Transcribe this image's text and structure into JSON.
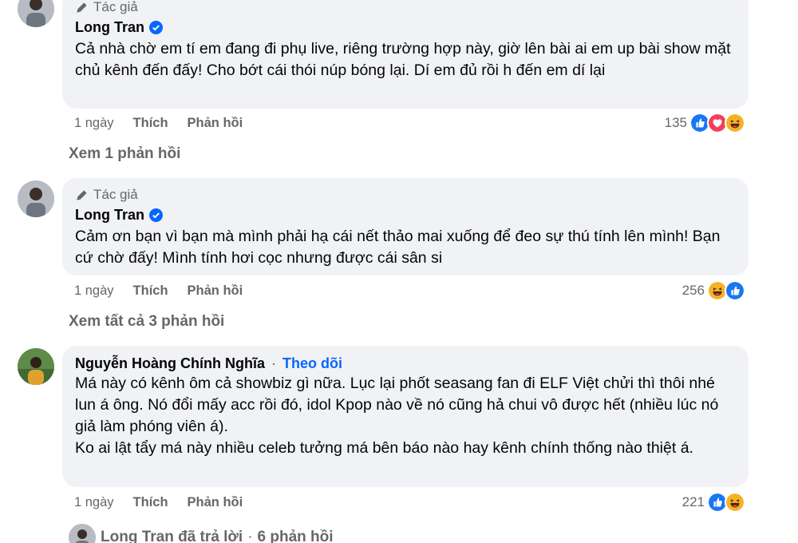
{
  "comments": [
    {
      "badge": "Tác giả",
      "author": "Long Tran",
      "verified": true,
      "text": "Cả nhà chờ em tí em đang đi phụ live, riêng trường hợp này, giờ lên bài ai em up bài show mặt chủ kênh đến đấy! Cho bớt cái thói núp bóng lại. Dí em đủ rồi h đến em dí lại",
      "time": "1 ngày",
      "like_label": "Thích",
      "reply_label": "Phản hồi",
      "reaction_count": "135",
      "reactions": [
        "like",
        "love",
        "haha"
      ],
      "view_replies": "Xem 1 phản hồi"
    },
    {
      "badge": "Tác giả",
      "author": "Long Tran",
      "verified": true,
      "text": "Cảm ơn bạn vì bạn mà mình phải hạ cái nết thảo mai xuống để đeo sự thú tính lên mình! Bạn cứ chờ đấy! Mình tính hơi cọc nhưng được cái sân si",
      "time": "1 ngày",
      "like_label": "Thích",
      "reply_label": "Phản hồi",
      "reaction_count": "256",
      "reactions": [
        "haha",
        "like"
      ],
      "view_replies": "Xem tất cả 3 phản hồi"
    },
    {
      "author": "Nguyễn Hoàng Chính Nghĩa",
      "follow_label": "Theo dõi",
      "separator": "·",
      "text_line1": "Má này có kênh ôm cả showbiz gì nữa. Lục lại phốt seasang fan đi ELF Việt chửi thì thôi nhé lun á ông. Nó đổi mấy acc rồi đó, idol Kpop nào về nó cũng hả chui vô được hết (nhiều lúc nó giả làm phóng viên á).",
      "text_line2": "Ko ai lật tẩy má này nhiều celeb tưởng má bên báo nào hay kênh chính thống nào thiệt á.",
      "time": "1 ngày",
      "like_label": "Thích",
      "reply_label": "Phản hồi",
      "reaction_count": "221",
      "reactions": [
        "like",
        "haha"
      ]
    }
  ],
  "replied_row": {
    "text": "Long Tran đã trả lời",
    "separator": "·",
    "count": "6 phản hồi"
  },
  "colors": {
    "bubble": "#f0f2f5",
    "secondary_text": "#65676b",
    "link_blue": "#0866ff",
    "like_blue": "#1877f2",
    "love_red": "#f33e58",
    "haha_yellow": "#f7b125"
  }
}
